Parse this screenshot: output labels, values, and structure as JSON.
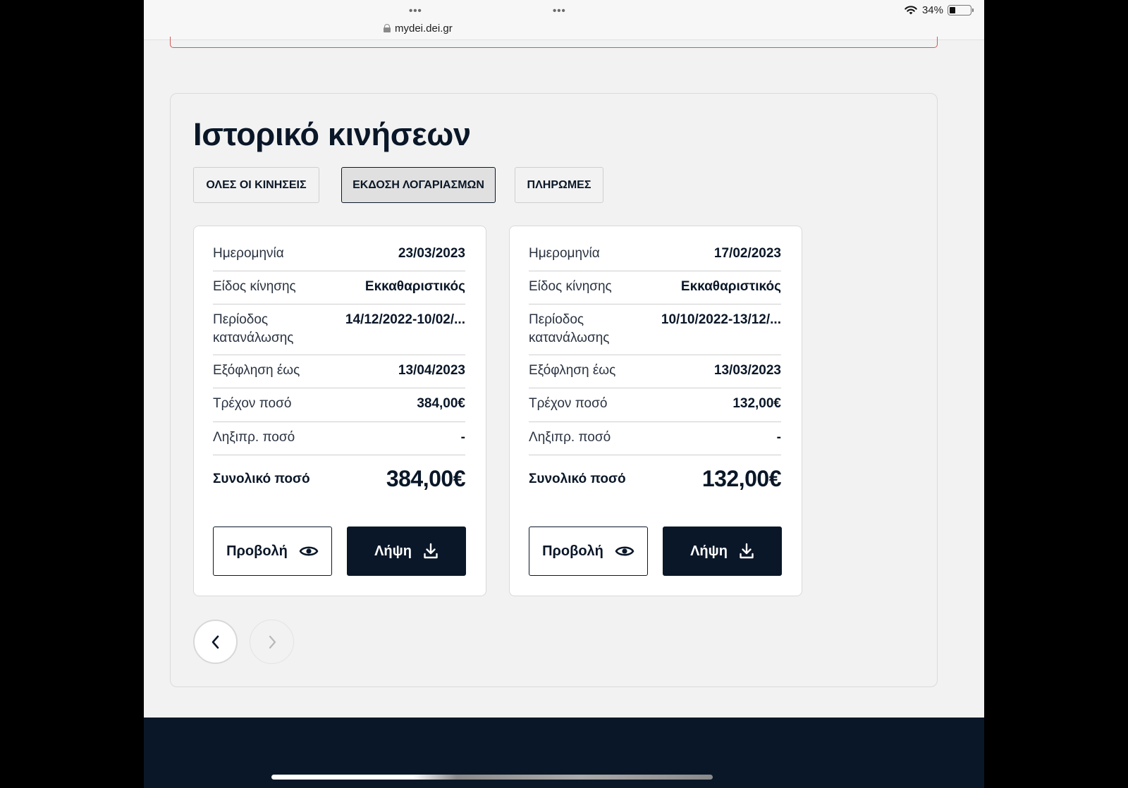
{
  "browser": {
    "url": "mydei.dei.gr",
    "battery_percent": "34%",
    "battery_level": 0.3
  },
  "history": {
    "title": "Ιστορικό κινήσεων",
    "tabs": [
      {
        "label": "ΟΛΕΣ ΟΙ ΚΙΝΗΣΕΙΣ",
        "active": false
      },
      {
        "label": "ΕΚΔΟΣΗ ΛΟΓΑΡΙΑΣΜΩΝ",
        "active": true
      },
      {
        "label": "ΠΛΗΡΩΜΕΣ",
        "active": false
      }
    ],
    "labels": {
      "date": "Ημερομηνία",
      "type": "Είδος κίνησης",
      "period_line1": "Περίοδος",
      "period_line2": "κατανάλωσης",
      "due": "Εξόφληση έως",
      "current": "Τρέχον ποσό",
      "overdue": "Ληξιπρ. ποσό",
      "total": "Συνολικό ποσό"
    },
    "buttons": {
      "view": "Προβολή",
      "download": "Λήψη"
    },
    "cards": [
      {
        "date": "23/03/2023",
        "type": "Εκκαθαριστικός",
        "period": "14/12/2022-10/02/...",
        "due": "13/04/2023",
        "current": "384,00€",
        "overdue": "-",
        "total": "384,00€"
      },
      {
        "date": "17/02/2023",
        "type": "Εκκαθαριστικός",
        "period": "10/10/2022-13/12/...",
        "due": "13/03/2023",
        "current": "132,00€",
        "overdue": "-",
        "total": "132,00€"
      }
    ]
  },
  "icons": {
    "view": "eye-icon",
    "download": "download-icon",
    "prev": "chevron-left-icon",
    "next": "chevron-right-icon"
  },
  "colors": {
    "navy": "#0a1728",
    "alert_border": "#cf5a5a",
    "background": "#f2f2f2"
  }
}
